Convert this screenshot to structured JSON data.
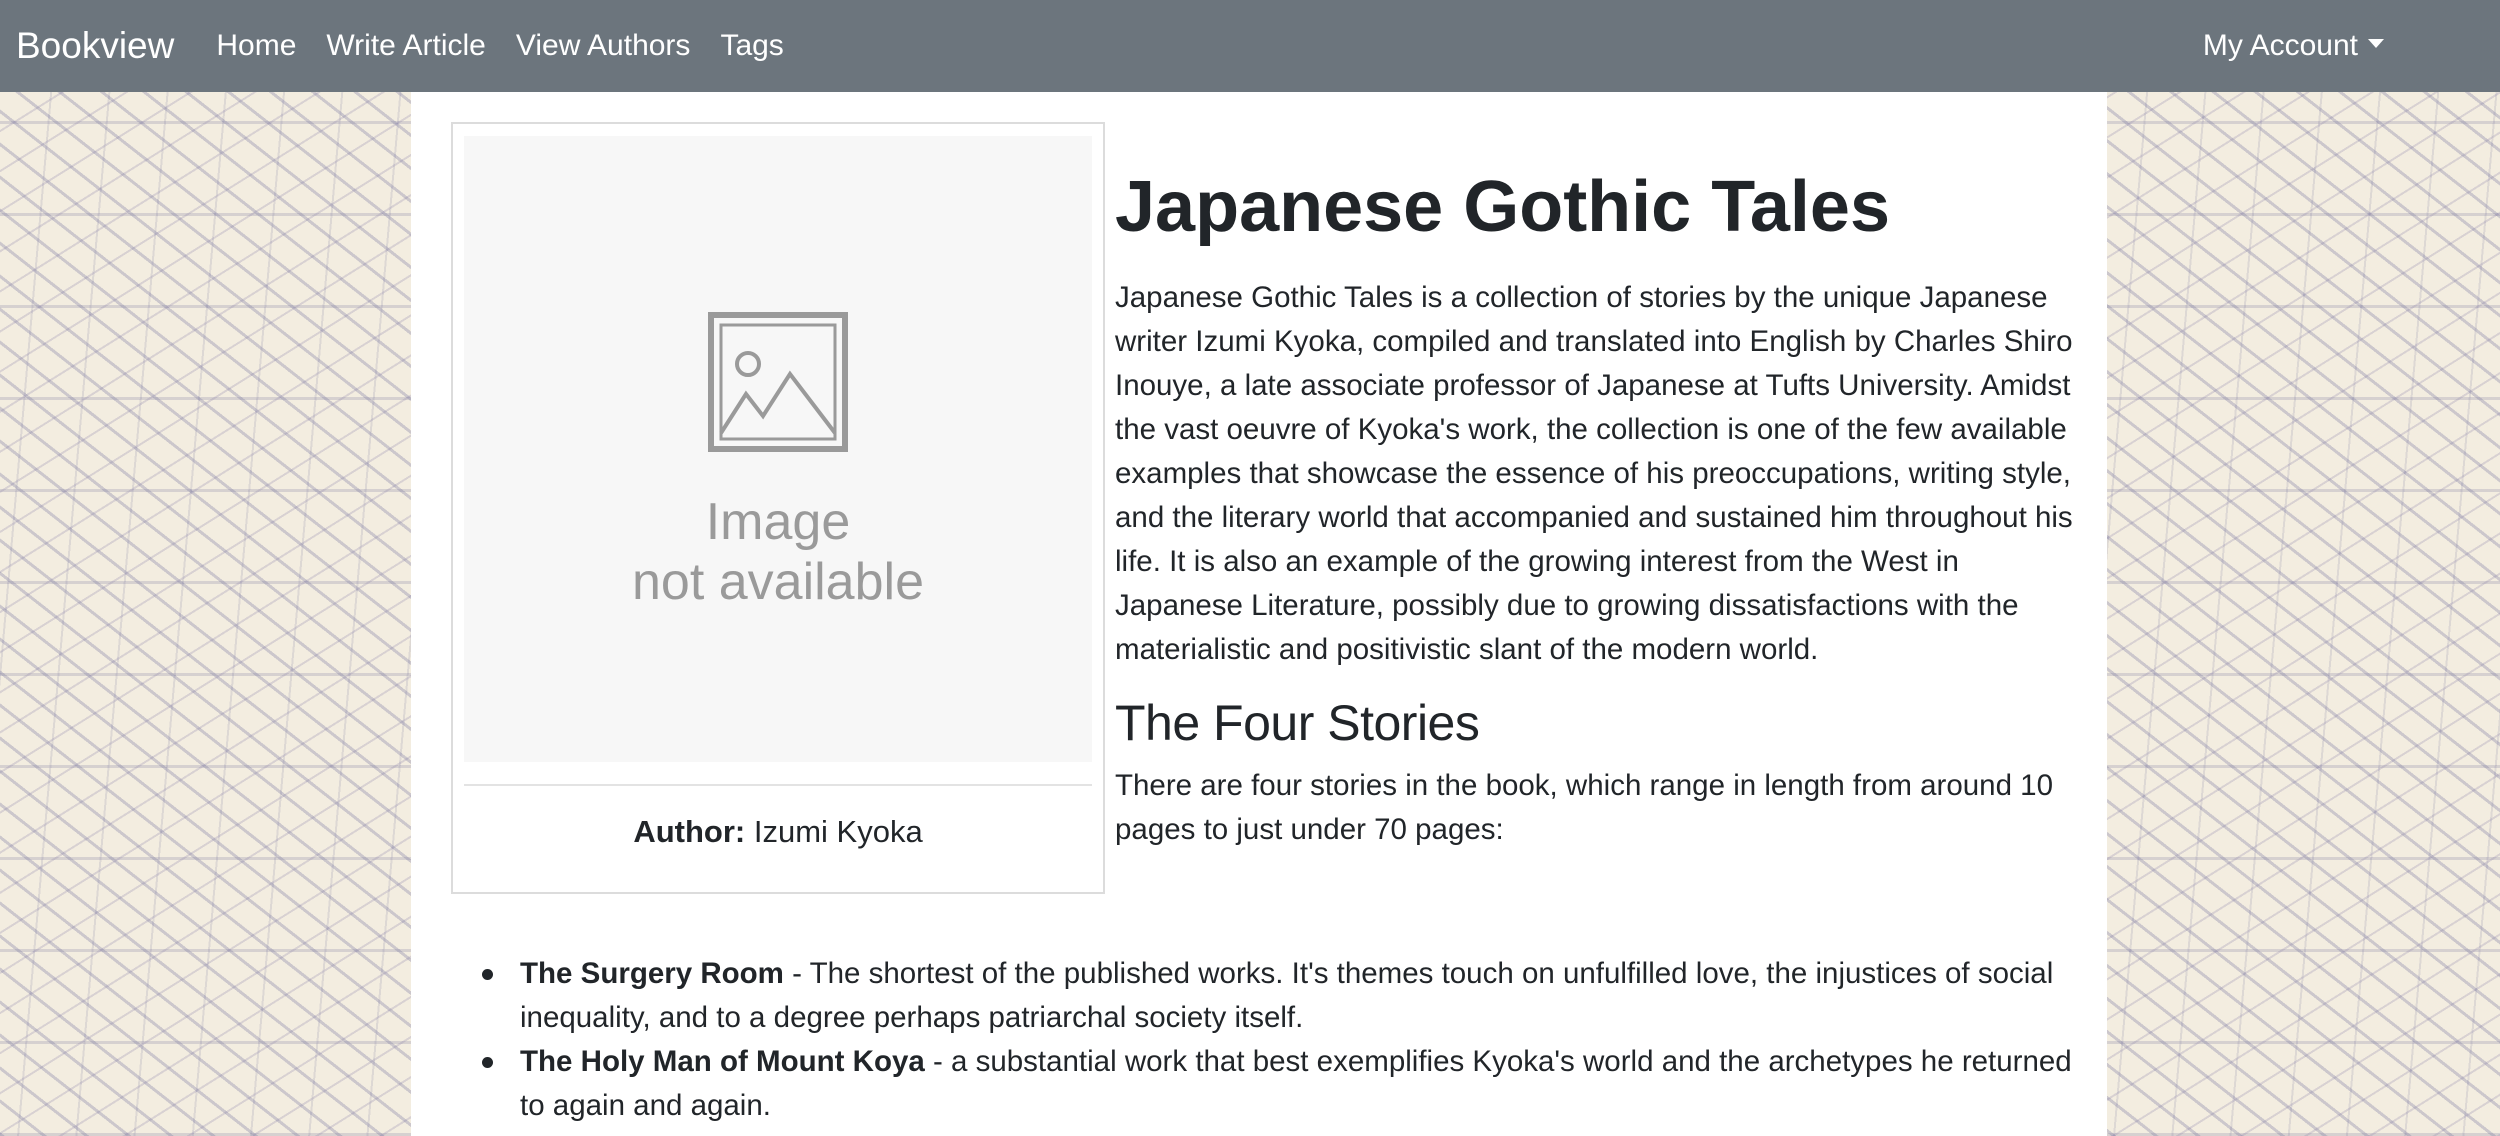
{
  "navbar": {
    "brand": "Bookview",
    "links": [
      "Home",
      "Write Article",
      "View Authors",
      "Tags"
    ],
    "account_label": "My Account"
  },
  "card": {
    "image_text_line1": "Image",
    "image_text_line2": "not available",
    "author_label": "Author:",
    "author_name": "Izumi Kyoka"
  },
  "article": {
    "title": "Japanese Gothic Tales",
    "intro": "Japanese Gothic Tales is a collection of stories by the unique Japanese writer Izumi Kyoka, compiled and translated into English by Charles Shiro Inouye, a late associate professor of Japanese at Tufts University. Amidst the vast oeuvre of Kyoka's work, the collection is one of the few available examples that showcase the essence of his preoccupations, writing style, and the literary world that accompanied and sustained him throughout his life. It is also an example of the growing interest from the West in Japanese Literature, possibly due to growing dissatisfactions with the materialistic and positivistic slant of the modern world.",
    "section_heading": "The Four Stories",
    "section_intro": "There are four stories in the book, which range in length from around 10 pages to just under 70 pages:",
    "stories": [
      {
        "name": "The Surgery Room",
        "desc": " - The shortest of the published works. It's themes touch on unfulfilled love, the injustices of social inequality, and to a degree perhaps patriarchal society itself."
      },
      {
        "name": "The Holy Man of Mount Koya",
        "desc": " - a substantial work that best exemplifies Kyoka's world and the archetypes he returned to again and again."
      }
    ]
  },
  "colors": {
    "navbar_bg": "#6c757d",
    "text": "#212529",
    "placeholder_bg": "#f7f7f7"
  },
  "icons": [
    "image-placeholder-icon",
    "caret-down-icon"
  ]
}
